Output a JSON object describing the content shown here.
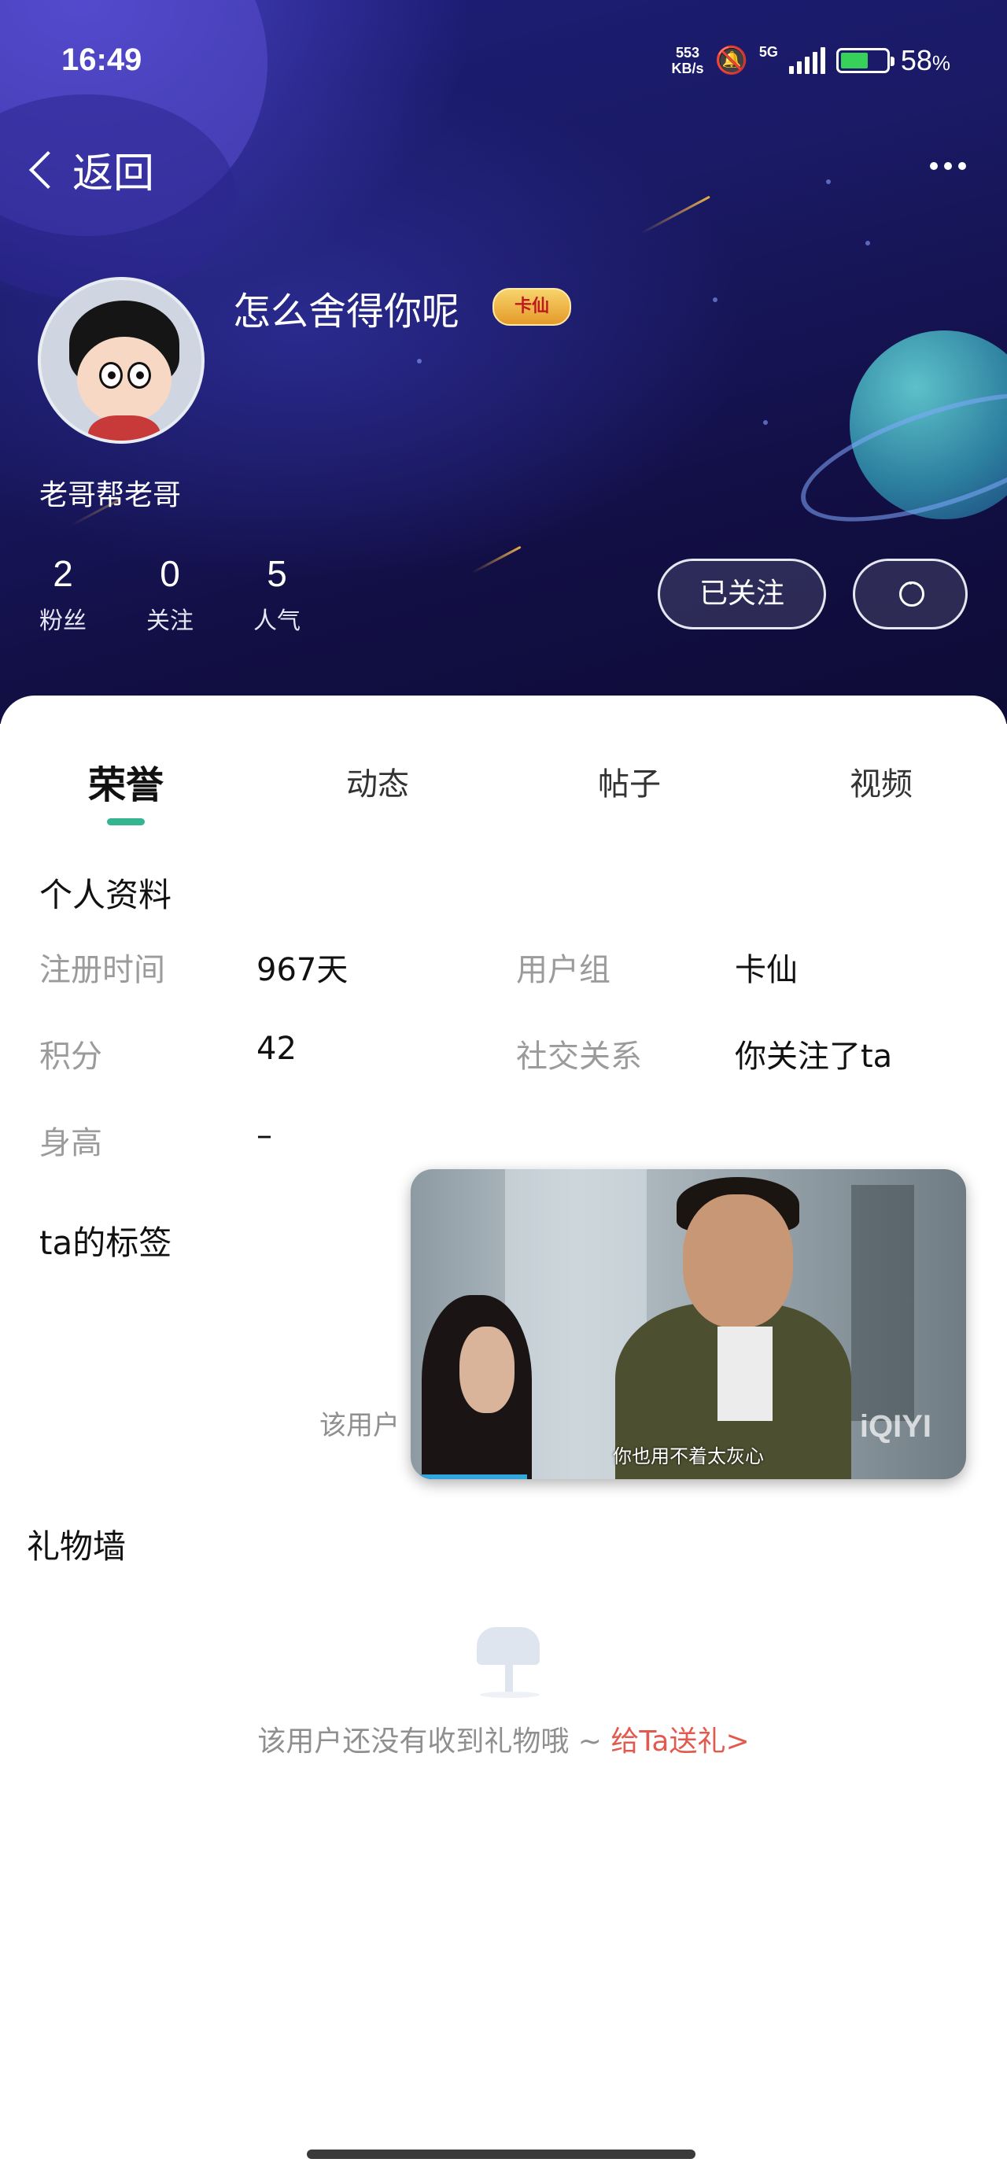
{
  "status_bar": {
    "time": "16:49",
    "net_speed_value": "553",
    "net_speed_unit": "KB/s",
    "network": "5G",
    "battery": "58",
    "battery_unit": "%"
  },
  "nav": {
    "back_label": "返回"
  },
  "profile": {
    "nickname": "怎么舍得你呢",
    "badge": "卡仙",
    "subname": "老哥帮老哥",
    "stats": [
      {
        "value": "2",
        "label": "粉丝"
      },
      {
        "value": "0",
        "label": "关注"
      },
      {
        "value": "5",
        "label": "人气"
      }
    ],
    "follow_label": "已关注"
  },
  "tabs": [
    "荣誉",
    "动态",
    "帖子",
    "视频"
  ],
  "active_tab": "荣誉",
  "personal_info": {
    "title": "个人资料",
    "fields": [
      {
        "label": "注册时间",
        "value": "967天"
      },
      {
        "label": "用户组",
        "value": "卡仙"
      },
      {
        "label": "积分",
        "value": "42"
      },
      {
        "label": "社交关系",
        "value": "你关注了ta"
      },
      {
        "label": "身高",
        "value": "–"
      }
    ]
  },
  "tags": {
    "title": "ta的标签",
    "empty_hint": "该用户"
  },
  "video_overlay": {
    "subtitle": "你也用不着太灰心",
    "logo": "iQIYI",
    "progress": 0.21
  },
  "gift_wall": {
    "title": "礼物墙",
    "empty_text": "该用户还没有收到礼物哦 ~ ",
    "link": "给Ta送礼>"
  },
  "colors": {
    "accent": "#34b58f",
    "link": "#e25a4e",
    "header_bg": "#1a1a66"
  }
}
